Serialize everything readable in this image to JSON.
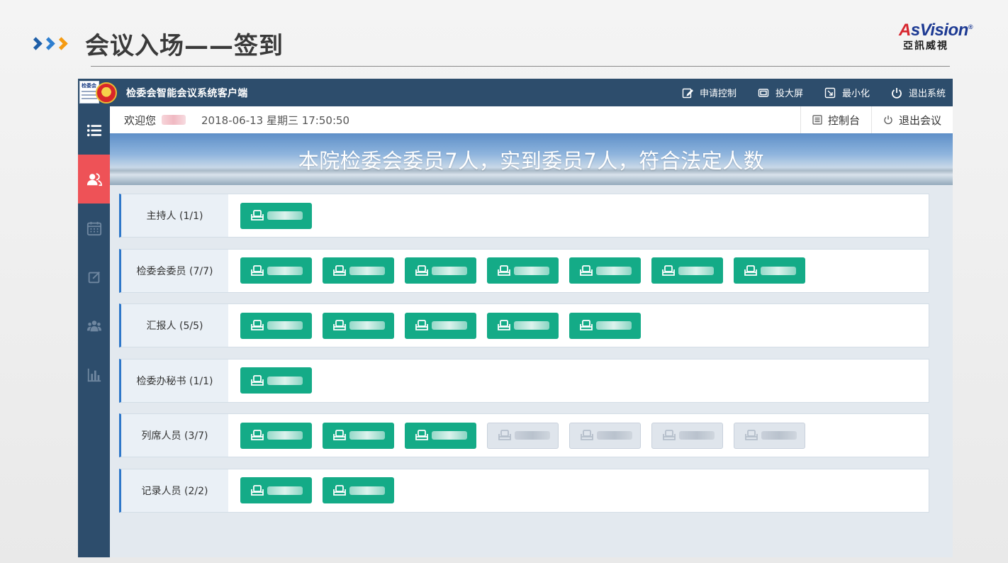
{
  "slide": {
    "title": "会议入场——签到",
    "brand_en_a": "A",
    "brand_en_rest": "sVision",
    "brand_mark": "®",
    "brand_cn": "亞訊威視"
  },
  "app": {
    "logo_text": "检委会",
    "title": "检委会智能会议系统客户端",
    "window_actions": [
      {
        "label": "申请控制",
        "icon": "edit-icon"
      },
      {
        "label": "投大屏",
        "icon": "screen-cast-icon"
      },
      {
        "label": "最小化",
        "icon": "minimize-icon"
      },
      {
        "label": "退出系统",
        "icon": "power-icon"
      }
    ]
  },
  "topbar": {
    "welcome": "欢迎您",
    "user_name": "",
    "datetime": "2018-06-13 星期三 17:50:50",
    "console_label": "控制台",
    "leave_label": "退出会议"
  },
  "banner": {
    "text": "本院检委会委员7人，实到委员7人，符合法定人数"
  },
  "sidebar": {
    "items": [
      {
        "icon": "menu-list-icon",
        "active": false
      },
      {
        "icon": "users-icon",
        "active": true
      },
      {
        "icon": "calendar-icon",
        "active": false
      },
      {
        "icon": "edit-icon",
        "active": false
      },
      {
        "icon": "group-icon",
        "active": false
      },
      {
        "icon": "bar-chart-icon",
        "active": false
      }
    ]
  },
  "colors": {
    "present_seat": "#14ab87",
    "absent_seat": "#dfe5ec",
    "titlebar": "#2d4d6c",
    "active_tab": "#ee5257",
    "row_accent": "#2e77c9"
  },
  "rows": [
    {
      "label": "主持人 (1/1)",
      "seats": [
        {
          "name": "",
          "present": true
        }
      ]
    },
    {
      "label": "检委会委员 (7/7)",
      "seats": [
        {
          "name": "",
          "present": true
        },
        {
          "name": "",
          "present": true
        },
        {
          "name": "",
          "present": true
        },
        {
          "name": "",
          "present": true
        },
        {
          "name": "",
          "present": true
        },
        {
          "name": "",
          "present": true
        },
        {
          "name": "",
          "present": true
        }
      ]
    },
    {
      "label": "汇报人 (5/5)",
      "seats": [
        {
          "name": "",
          "present": true
        },
        {
          "name": "",
          "present": true
        },
        {
          "name": "",
          "present": true
        },
        {
          "name": "",
          "present": true
        },
        {
          "name": "",
          "present": true
        }
      ]
    },
    {
      "label": "检委办秘书 (1/1)",
      "seats": [
        {
          "name": "",
          "present": true
        }
      ]
    },
    {
      "label": "列席人员 (3/7)",
      "seats": [
        {
          "name": "",
          "present": true
        },
        {
          "name": "",
          "present": true
        },
        {
          "name": "",
          "present": true
        },
        {
          "name": "",
          "present": false
        },
        {
          "name": "",
          "present": false
        },
        {
          "name": "",
          "present": false
        },
        {
          "name": "",
          "present": false
        }
      ]
    },
    {
      "label": "记录人员 (2/2)",
      "seats": [
        {
          "name": "",
          "present": true
        },
        {
          "name": "",
          "present": true
        }
      ]
    }
  ]
}
